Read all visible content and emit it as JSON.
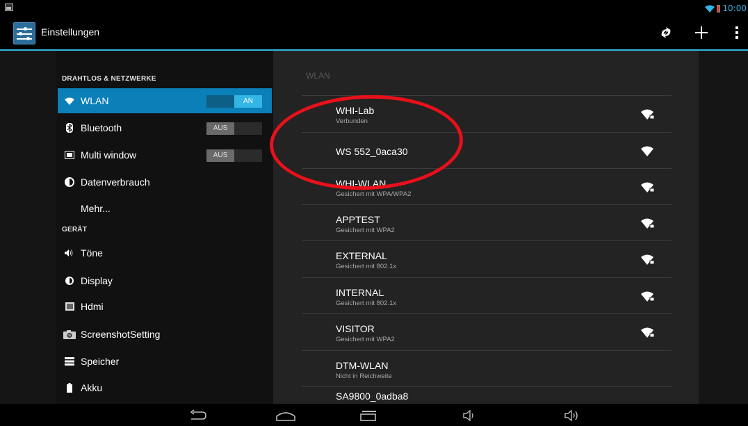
{
  "status_bar": {
    "time": "10:00",
    "icons": [
      "picture-notification-icon",
      "wifi-status-icon",
      "battery-icon"
    ],
    "colors": {
      "accent": "#33b5e5",
      "battery": "#d93d2f"
    }
  },
  "action_bar": {
    "title": "Einstellungen",
    "icons": [
      "settings-app-icon",
      "sync-icon",
      "add-icon",
      "overflow-menu-icon"
    ]
  },
  "left": {
    "section_wireless": "DRAHTLOS & NETZWERKE",
    "section_device": "GERÄT",
    "items": [
      {
        "label": "WLAN",
        "icon": "wifi-icon",
        "toggle": "AN",
        "active": true
      },
      {
        "label": "Bluetooth",
        "icon": "bluetooth-icon",
        "toggle": "AUS"
      },
      {
        "label": "Multi window",
        "icon": "multi-window-icon",
        "toggle": "AUS"
      },
      {
        "label": "Datenverbrauch",
        "icon": "data-usage-icon"
      },
      {
        "label": "Mehr..."
      },
      {
        "label": "Töne",
        "icon": "sound-icon"
      },
      {
        "label": "Display",
        "icon": "display-icon"
      },
      {
        "label": "Hdmi",
        "icon": "hdmi-icon"
      },
      {
        "label": "ScreenshotSetting",
        "icon": "camera-icon"
      },
      {
        "label": "Speicher",
        "icon": "storage-icon"
      },
      {
        "label": "Akku",
        "icon": "battery-icon"
      }
    ]
  },
  "right": {
    "header": "WLAN",
    "networks": [
      {
        "name": "WHI-Lab",
        "status": "Verbunden",
        "secured": true
      },
      {
        "name": "WS 552_0aca30",
        "status": "",
        "secured": false
      },
      {
        "name": "WHI-WLAN",
        "status": "Gesichert mit WPA/WPA2",
        "secured": true
      },
      {
        "name": "APPTEST",
        "status": "Gesichert mit WPA2",
        "secured": true
      },
      {
        "name": "EXTERNAL",
        "status": "Gesichert mit 802.1x",
        "secured": true
      },
      {
        "name": "INTERNAL",
        "status": "Gesichert mit 802.1x",
        "secured": true
      },
      {
        "name": "VISITOR",
        "status": "Gesichert mit WPA2",
        "secured": true
      },
      {
        "name": "DTM-WLAN",
        "status": "Nicht in Reichweite",
        "secured": false
      },
      {
        "name": "SA9800_0adba8",
        "status": "",
        "secured": false
      }
    ]
  },
  "nav_bar": {
    "icons": [
      "back-icon",
      "home-icon",
      "recent-apps-icon",
      "volume-down-icon",
      "volume-up-icon"
    ]
  }
}
